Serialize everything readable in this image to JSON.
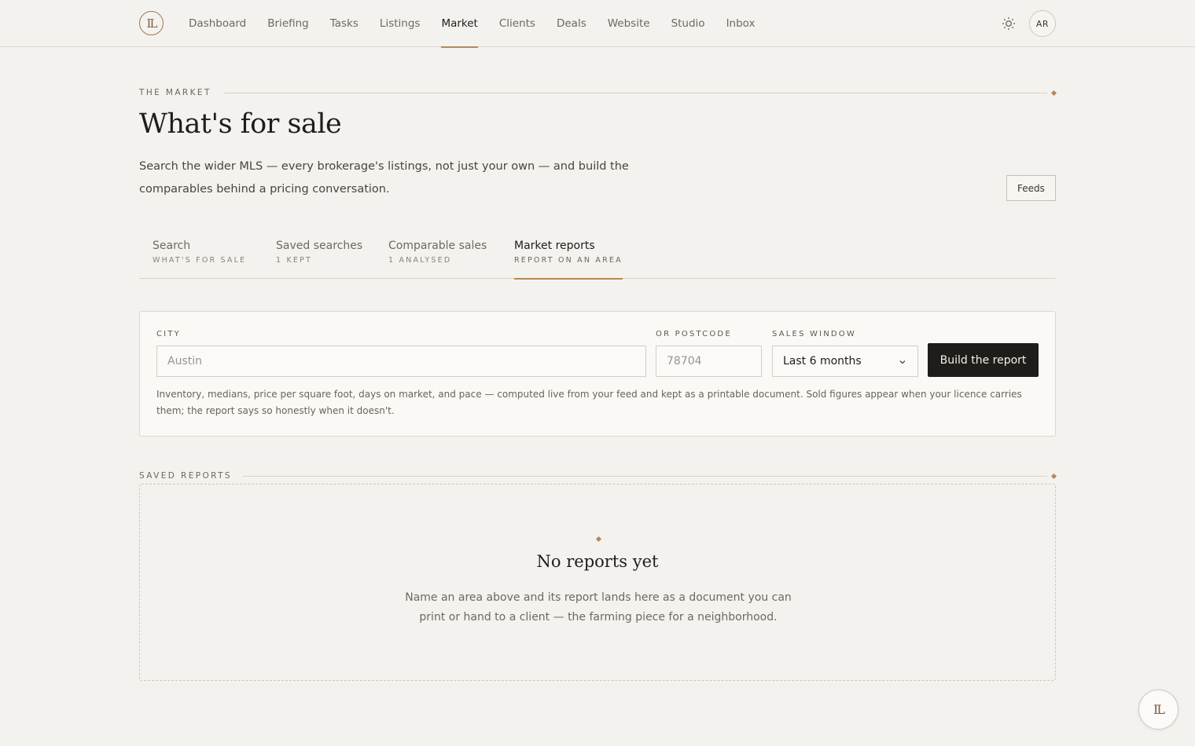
{
  "app": {
    "logo_text": "IL",
    "avatar_initials": "AR"
  },
  "nav": {
    "items": [
      {
        "label": "Dashboard",
        "name": "nav-dashboard"
      },
      {
        "label": "Briefing",
        "name": "nav-briefing"
      },
      {
        "label": "Tasks",
        "name": "nav-tasks"
      },
      {
        "label": "Listings",
        "name": "nav-listings"
      },
      {
        "label": "Market",
        "name": "nav-market",
        "active": true
      },
      {
        "label": "Clients",
        "name": "nav-clients"
      },
      {
        "label": "Deals",
        "name": "nav-deals"
      },
      {
        "label": "Website",
        "name": "nav-website"
      },
      {
        "label": "Studio",
        "name": "nav-studio"
      },
      {
        "label": "Inbox",
        "name": "nav-inbox"
      }
    ]
  },
  "header": {
    "eyebrow": "THE MARKET",
    "title": "What's for sale",
    "description": "Search the wider MLS — every brokerage's listings, not just your own — and build the comparables behind a pricing conversation.",
    "feeds_label": "Feeds"
  },
  "tabs": [
    {
      "label": "Search",
      "sub": "WHAT'S FOR SALE"
    },
    {
      "label": "Saved searches",
      "sub": "1 KEPT"
    },
    {
      "label": "Comparable sales",
      "sub": "1 ANALYSED"
    },
    {
      "label": "Market reports",
      "sub": "REPORT ON AN AREA",
      "active": true
    }
  ],
  "report_form": {
    "city_label": "CITY",
    "city_placeholder": "Austin",
    "postcode_label": "OR POSTCODE",
    "postcode_placeholder": "78704",
    "window_label": "SALES WINDOW",
    "window_value": "Last 6 months",
    "build_label": "Build the report",
    "note": "Inventory, medians, price per square foot, days on market, and pace — computed live from your feed and kept as a printable document. Sold figures appear when your licence carries them; the report says so honestly when it doesn't."
  },
  "saved_reports": {
    "label": "SAVED REPORTS",
    "empty_title": "No reports yet",
    "empty_text": "Name an area above and its report lands here as a document you can print or hand to a client — the farming piece for a neighborhood."
  },
  "colors": {
    "accent": "#b08a5e",
    "background": "#f4f2ee",
    "button_dark": "#1f1c1a"
  },
  "icons": {
    "theme": "sun-icon",
    "select": "chevron-down-icon"
  }
}
